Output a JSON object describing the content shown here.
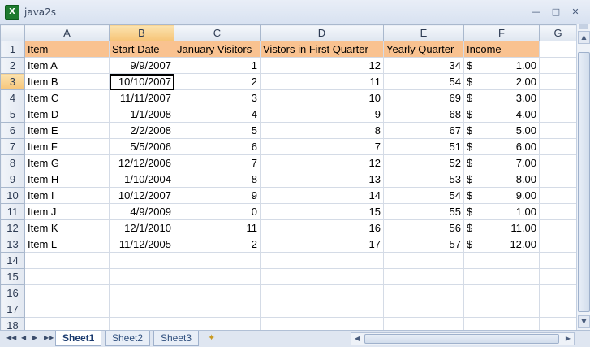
{
  "window": {
    "title": "java2s",
    "app_icon": "X"
  },
  "grid": {
    "column_letters": [
      "A",
      "B",
      "C",
      "D",
      "E",
      "F",
      "G"
    ],
    "active_column": "B",
    "active_row": 3,
    "header": [
      "Item",
      "Start Date",
      "January Visitors",
      "Vistors in First Quarter",
      "Yearly Quarter",
      "Income"
    ],
    "rows": [
      [
        "Item A",
        "9/9/2007",
        "1",
        "12",
        "34",
        "$",
        "1.00"
      ],
      [
        "Item B",
        "10/10/2007",
        "2",
        "11",
        "54",
        "$",
        "2.00"
      ],
      [
        "Item C",
        "11/11/2007",
        "3",
        "10",
        "69",
        "$",
        "3.00"
      ],
      [
        "Item D",
        "1/1/2008",
        "4",
        "9",
        "68",
        "$",
        "4.00"
      ],
      [
        "Item E",
        "2/2/2008",
        "5",
        "8",
        "67",
        "$",
        "5.00"
      ],
      [
        "Item F",
        "5/5/2006",
        "6",
        "7",
        "51",
        "$",
        "6.00"
      ],
      [
        "Item G",
        "12/12/2006",
        "7",
        "12",
        "52",
        "$",
        "7.00"
      ],
      [
        "Item H",
        "1/10/2004",
        "8",
        "13",
        "53",
        "$",
        "8.00"
      ],
      [
        "Item I",
        "10/12/2007",
        "9",
        "14",
        "54",
        "$",
        "9.00"
      ],
      [
        "Item J",
        "4/9/2009",
        "0",
        "15",
        "55",
        "$",
        "1.00"
      ],
      [
        "Item K",
        "12/1/2010",
        "11",
        "16",
        "56",
        "$",
        "11.00"
      ],
      [
        "Item L",
        "11/12/2005",
        "2",
        "17",
        "57",
        "$",
        "12.00"
      ]
    ],
    "row_numbers": [
      "1",
      "2",
      "3",
      "4",
      "5",
      "6",
      "7",
      "8",
      "9",
      "10",
      "11",
      "12",
      "13",
      "14",
      "15",
      "16",
      "17",
      "18"
    ]
  },
  "sheets": {
    "tabs": [
      "Sheet1",
      "Sheet2",
      "Sheet3"
    ],
    "active": "Sheet1"
  },
  "icons": {
    "nav": [
      "first-sheet-icon",
      "prev-sheet-icon",
      "next-sheet-icon",
      "last-sheet-icon"
    ],
    "new_sheet": "insert-sheet-icon"
  },
  "colors": {
    "header_row_fill": "#f9c290",
    "active_header": "#f6c477"
  }
}
